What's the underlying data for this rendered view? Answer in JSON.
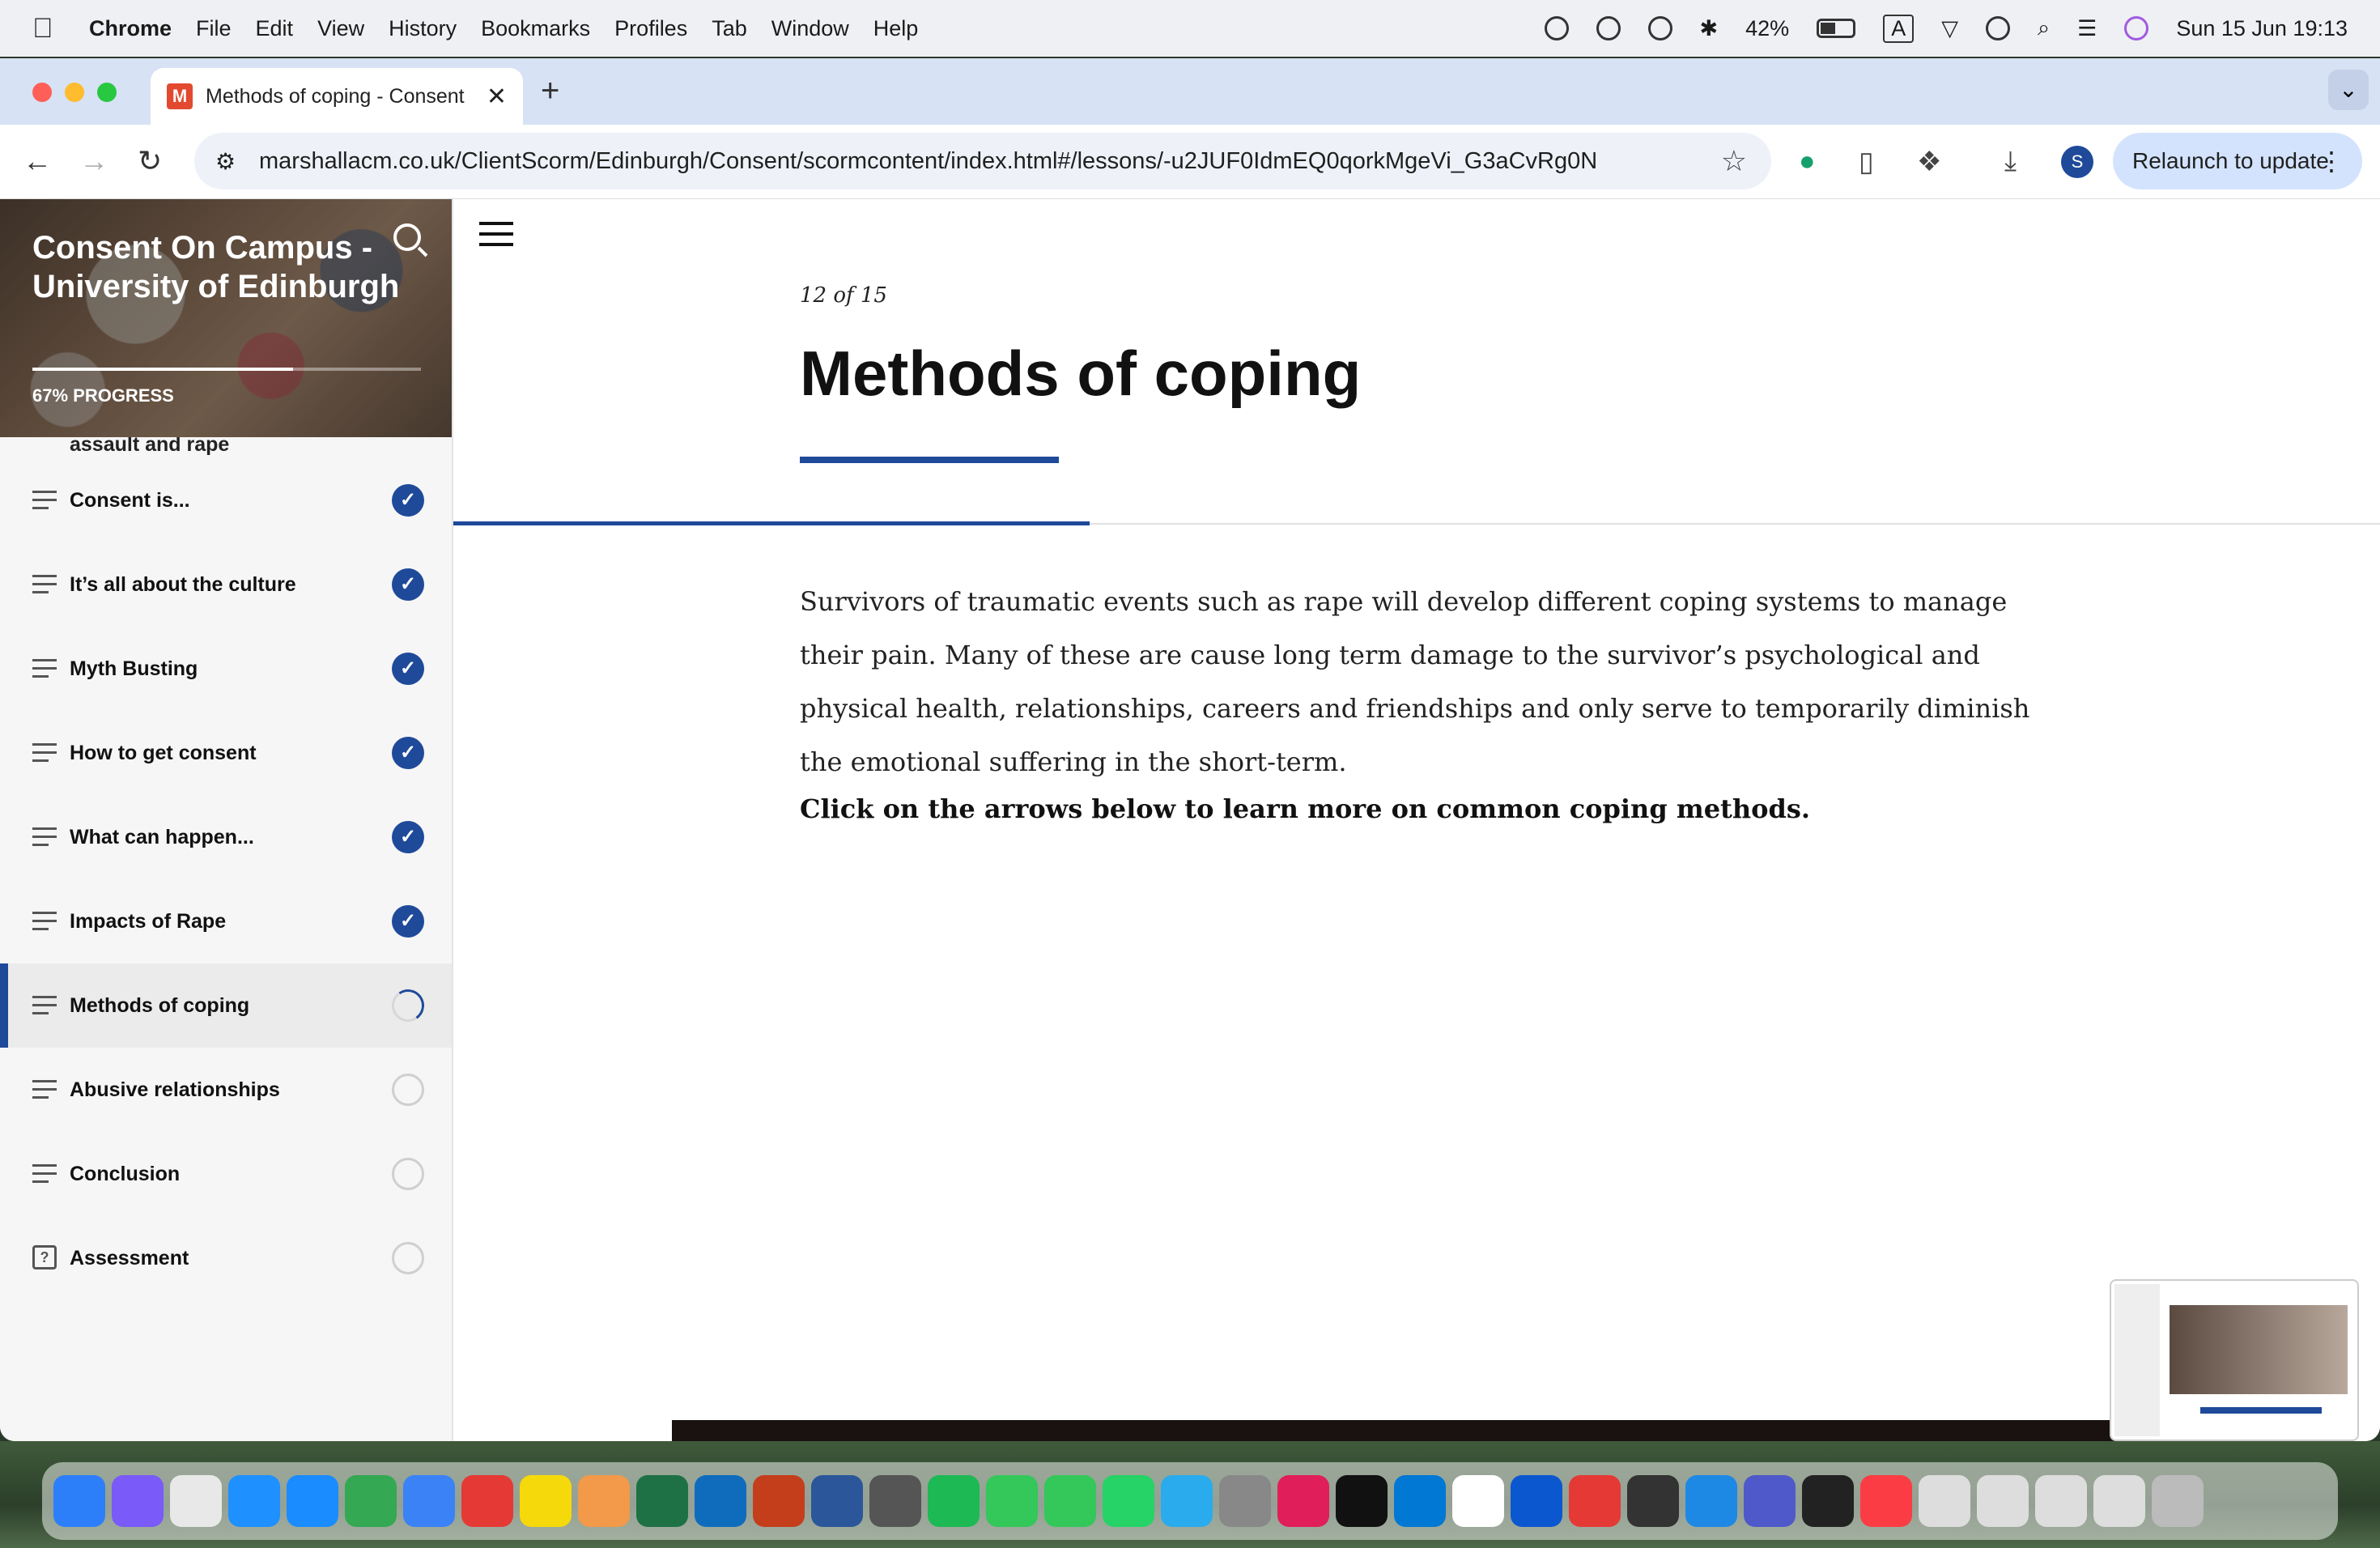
{
  "menubar": {
    "app": "Chrome",
    "items": [
      "File",
      "Edit",
      "View",
      "History",
      "Bookmarks",
      "Profiles",
      "Tab",
      "Window",
      "Help"
    ],
    "battery": "42%",
    "input_source": "A",
    "datetime": "Sun 15 Jun  19:13"
  },
  "browser": {
    "tab_title": "Methods of coping - Consent",
    "tab_favicon": "M",
    "url": "marshallacm.co.uk/ClientScorm/Edinburgh/Consent/scormcontent/index.html#/lessons/-u2JUF0IdmEQ0qorkMgeVi_G3aCvRg0N",
    "profile_initial": "S",
    "relaunch_label": "Relaunch to update"
  },
  "sidebar": {
    "course_title": "Consent On Campus - University of Edinburgh",
    "progress_label": "67% PROGRESS",
    "progress_value": 0.67,
    "partial_item": "assault and rape",
    "lessons": [
      {
        "label": "Consent is...",
        "status": "done",
        "icon": "lines"
      },
      {
        "label": "It’s all about the culture",
        "status": "done",
        "icon": "lines"
      },
      {
        "label": "Myth Busting",
        "status": "done",
        "icon": "lines"
      },
      {
        "label": "How to get consent",
        "status": "done",
        "icon": "lines"
      },
      {
        "label": "What can happen...",
        "status": "done",
        "icon": "lines"
      },
      {
        "label": "Impacts of Rape",
        "status": "done",
        "icon": "lines"
      },
      {
        "label": "Methods of coping",
        "status": "in-progress",
        "icon": "lines",
        "active": true
      },
      {
        "label": "Abusive relationships",
        "status": "not-started",
        "icon": "lines"
      },
      {
        "label": "Conclusion",
        "status": "not-started",
        "icon": "lines"
      },
      {
        "label": "Assessment",
        "status": "not-started",
        "icon": "question"
      }
    ]
  },
  "lesson": {
    "counter": "12 of 15",
    "title": "Methods of coping",
    "body": "Survivors of traumatic events such as rape will develop different coping systems to manage their pain. Many of these are cause long term damage to the survivor’s psychological and physical health, relationships, careers and friendships and only serve to temporarily diminish the emotional suffering in the short-term.",
    "cta": "Click on the arrows below to learn more on common coping methods."
  },
  "colors": {
    "accent": "#1f4a9a",
    "tabbar": "#d7e2f5",
    "relaunch": "#d3e3fd"
  }
}
